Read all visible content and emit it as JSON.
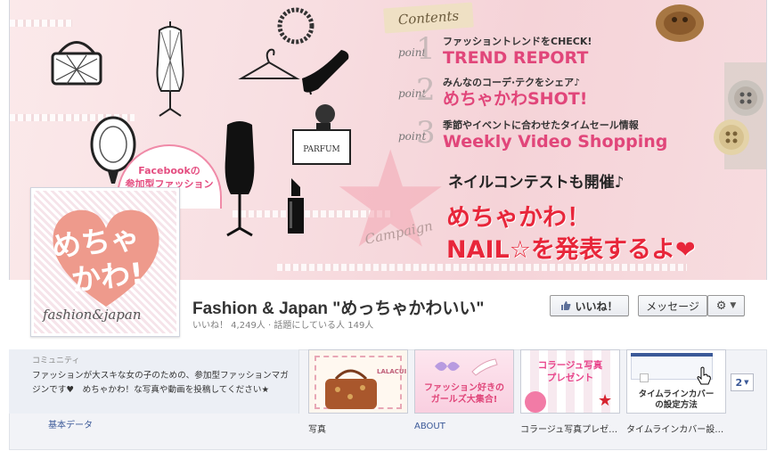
{
  "cover": {
    "contents_label": "Contents",
    "point_word": "point",
    "points": [
      {
        "num": "1",
        "sub": "ファッショントレンドをCHECK!",
        "main": "TREND REPORT"
      },
      {
        "num": "2",
        "sub": "みんなのコーデ·テクをシェア♪",
        "main": "めちゃかわSHOT!"
      },
      {
        "num": "3",
        "sub": "季節やイベントに合わせたタイムセール情報",
        "main": "Weekly Video Shopping"
      }
    ],
    "nail_contest": "ネイルコンテストも開催♪",
    "nail_line1": "めちゃかわ！",
    "nail_line2": "NAIL☆を発表するよ❤",
    "campaign": "Campaign",
    "badge_line1": "Facebookの",
    "badge_line2": "参加型ファッション",
    "perfume_label": "PARFUM"
  },
  "profile": {
    "logo_line1": "めちゃ",
    "logo_line2": "かわ!",
    "logo_sub": "fashion&japan",
    "heart_color": "#ee9a8c"
  },
  "page": {
    "name": "Fashion & Japan \"めっちゃかわいい\"",
    "stats": "いいね！ 4,249人 · 話題にしている人 149人"
  },
  "actions": {
    "like_label": "いいね！",
    "message_label": "メッセージ"
  },
  "about": {
    "category": "コミュニティ",
    "description": "ファッションが大スキな女の子のための、参加型ファッションマガジンです♥　めちゃかわ！な写真や動画を投稿してください★",
    "basic_data": "基本データ"
  },
  "tiles": [
    {
      "label": "写真",
      "art": "LALACUI"
    },
    {
      "label": "ABOUT",
      "art_line1": "ファッション好きの",
      "art_line2": "ガールズ大集合!"
    },
    {
      "label": "コラージュ写真プレゼ…",
      "art_line1": "コラージュ写真",
      "art_line2": "プレゼント"
    },
    {
      "label": "タイムラインカバー設…",
      "art_line1": "タイムラインカバー",
      "art_line2": "の設定方法"
    }
  ],
  "more_count": "2",
  "colors": {
    "link": "#3b5998",
    "accent_pink": "#e1467a",
    "nail_red": "#e8263a"
  }
}
